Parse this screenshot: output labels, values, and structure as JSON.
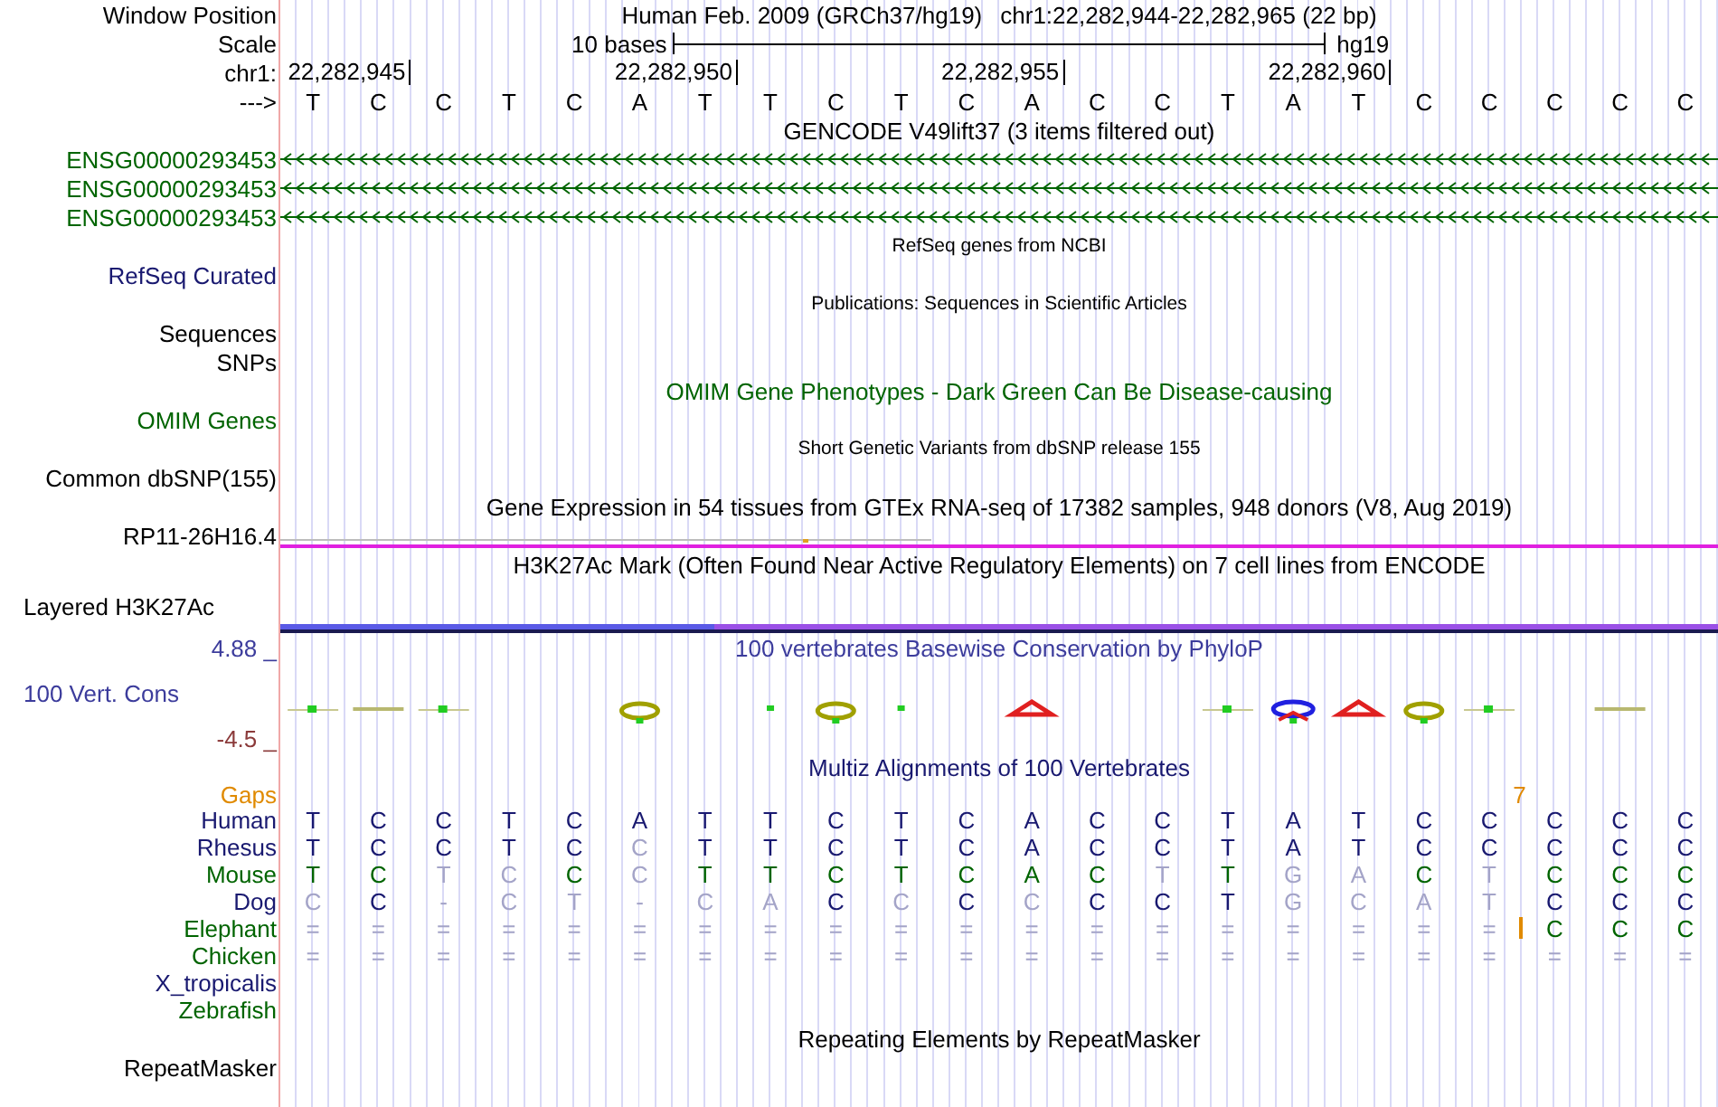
{
  "window_position": {
    "label": "Window Position",
    "assembly": "Human Feb. 2009 (GRCh37/hg19)",
    "range": "chr1:22,282,944-22,282,965 (22 bp)"
  },
  "scale": {
    "label": "Scale",
    "span": "10 bases",
    "assembly": "hg19"
  },
  "ruler": {
    "label": "chr1:",
    "ticks": [
      "22,282,945",
      "22,282,950",
      "22,282,955",
      "22,282,960"
    ]
  },
  "sequence": {
    "label": "--->",
    "bases": [
      "T",
      "C",
      "C",
      "T",
      "C",
      "A",
      "T",
      "T",
      "C",
      "T",
      "C",
      "A",
      "C",
      "C",
      "T",
      "A",
      "T",
      "C",
      "C",
      "C",
      "C",
      "C"
    ]
  },
  "tracks": [
    {
      "kind": "plain",
      "title": {
        "text": "GENCODE V49lift37 (3 items filtered out)",
        "color": "#000000"
      }
    },
    {
      "kind": "gene",
      "label": "ENSG00000293453",
      "color": "#006400"
    },
    {
      "kind": "gene",
      "label": "ENSG00000293453",
      "color": "#006400"
    },
    {
      "kind": "gene",
      "label": "ENSG00000293453",
      "color": "#006400"
    },
    {
      "kind": "note",
      "title": {
        "text": "RefSeq genes from NCBI",
        "color": "#000000"
      }
    },
    {
      "kind": "plain",
      "label": "RefSeq Curated",
      "color": "#191970"
    },
    {
      "kind": "note",
      "title": {
        "text": "Publications: Sequences in Scientific Articles",
        "color": "#000000"
      }
    },
    {
      "kind": "plain",
      "label": "Sequences",
      "color": "#000000"
    },
    {
      "kind": "plain",
      "label": "SNPs",
      "color": "#000000"
    },
    {
      "kind": "plain",
      "title": {
        "text": "OMIM Gene Phenotypes - Dark Green Can Be Disease-causing",
        "color": "#006400"
      }
    },
    {
      "kind": "plain",
      "label": "OMIM Genes",
      "color": "#006400"
    },
    {
      "kind": "note",
      "title": {
        "text": "Short Genetic Variants from dbSNP release 155",
        "color": "#000000"
      }
    },
    {
      "kind": "plain",
      "label": "Common dbSNP(155)",
      "color": "#000000"
    },
    {
      "kind": "plain",
      "title": {
        "text": "Gene Expression in 54 tissues from GTEx RNA-seq of 17382 samples, 948 donors (V8, Aug 2019)",
        "color": "#000000"
      }
    },
    {
      "kind": "expression",
      "label": "RP11-26H16.4",
      "color": "#000000"
    },
    {
      "kind": "plain",
      "title": {
        "text": "H3K27Ac Mark (Often Found Near Active Regulatory Elements) on 7 cell lines from ENCODE",
        "color": "#000000"
      }
    },
    {
      "kind": "signal",
      "label": "Layered H3K27Ac",
      "color": "#000000"
    },
    {
      "kind": "plain",
      "label": "4.88 _",
      "color": "#3c3c9c",
      "title": {
        "text": "100 vertebrates Basewise Conservation by PhyloP",
        "color": "#3c3c9c"
      }
    },
    {
      "kind": "conservation",
      "label": "100 Vert. Cons",
      "color": "#3c3c9c"
    },
    {
      "kind": "plain",
      "label": "-4.5 _",
      "color": "#8b3a3a"
    },
    {
      "kind": "plain",
      "title": {
        "text": "Multiz Alignments of 100 Vertebrates",
        "color": "#191970"
      }
    },
    {
      "kind": "gaps",
      "label": "Gaps",
      "color": "#e08a00",
      "count": "7"
    },
    {
      "kind": "alignment",
      "label": "Human",
      "color": "#191970",
      "bases": [
        "T",
        "C",
        "C",
        "T",
        "C",
        "A",
        "T",
        "T",
        "C",
        "T",
        "C",
        "A",
        "C",
        "C",
        "T",
        "A",
        "T",
        "C",
        "C",
        "C",
        "C",
        "C"
      ],
      "faded": [
        false,
        false,
        false,
        false,
        false,
        false,
        false,
        false,
        false,
        false,
        false,
        false,
        false,
        false,
        false,
        false,
        false,
        false,
        false,
        false,
        false,
        false
      ]
    },
    {
      "kind": "alignment",
      "label": "Rhesus",
      "color": "#191970",
      "bases": [
        "T",
        "C",
        "C",
        "T",
        "C",
        "C",
        "T",
        "T",
        "C",
        "T",
        "C",
        "A",
        "C",
        "C",
        "T",
        "A",
        "T",
        "C",
        "C",
        "C",
        "C",
        "C"
      ],
      "faded": [
        false,
        false,
        false,
        false,
        false,
        true,
        false,
        false,
        false,
        false,
        false,
        false,
        false,
        false,
        false,
        false,
        false,
        false,
        false,
        false,
        false,
        false
      ]
    },
    {
      "kind": "alignment",
      "label": "Mouse",
      "color": "#006400",
      "bases": [
        "T",
        "C",
        "T",
        "C",
        "C",
        "C",
        "T",
        "T",
        "C",
        "T",
        "C",
        "A",
        "C",
        "T",
        "T",
        "G",
        "A",
        "C",
        "T",
        "C",
        "C",
        "C"
      ],
      "faded": [
        false,
        false,
        true,
        true,
        false,
        true,
        false,
        false,
        false,
        false,
        false,
        false,
        false,
        true,
        false,
        true,
        true,
        false,
        true,
        false,
        false,
        false
      ]
    },
    {
      "kind": "alignment",
      "label": "Dog",
      "color": "#191970",
      "bases": [
        "C",
        "C",
        "-",
        "C",
        "T",
        "-",
        "C",
        "A",
        "C",
        "C",
        "C",
        "C",
        "C",
        "C",
        "T",
        "G",
        "C",
        "A",
        "T",
        "C",
        "C",
        "C"
      ],
      "faded": [
        true,
        false,
        true,
        true,
        true,
        true,
        true,
        true,
        false,
        true,
        false,
        true,
        false,
        false,
        false,
        true,
        true,
        true,
        true,
        false,
        false,
        false
      ]
    },
    {
      "kind": "alignment",
      "label": "Elephant",
      "color": "#006400",
      "bases": [
        "=",
        "=",
        "=",
        "=",
        "=",
        "=",
        "=",
        "=",
        "=",
        "=",
        "=",
        "=",
        "=",
        "=",
        "=",
        "=",
        "=",
        "=",
        "=",
        "C",
        "C",
        "C"
      ],
      "faded": [
        true,
        true,
        true,
        true,
        true,
        true,
        true,
        true,
        true,
        true,
        true,
        true,
        true,
        true,
        true,
        true,
        true,
        true,
        true,
        false,
        false,
        false
      ],
      "insert_before": [
        false,
        false,
        false,
        false,
        false,
        false,
        false,
        false,
        false,
        false,
        false,
        false,
        false,
        false,
        false,
        false,
        false,
        false,
        false,
        true,
        false,
        false
      ]
    },
    {
      "kind": "alignment",
      "label": "Chicken",
      "color": "#006400",
      "bases": [
        "=",
        "=",
        "=",
        "=",
        "=",
        "=",
        "=",
        "=",
        "=",
        "=",
        "=",
        "=",
        "=",
        "=",
        "=",
        "=",
        "=",
        "=",
        "=",
        "=",
        "=",
        "="
      ],
      "faded": [
        true,
        true,
        true,
        true,
        true,
        true,
        true,
        true,
        true,
        true,
        true,
        true,
        true,
        true,
        true,
        true,
        true,
        true,
        true,
        true,
        true,
        true
      ]
    },
    {
      "kind": "alignment",
      "label": "X_tropicalis",
      "color": "#191970"
    },
    {
      "kind": "alignment",
      "label": "Zebrafish",
      "color": "#006400"
    },
    {
      "kind": "plain",
      "title": {
        "text": "Repeating Elements by RepeatMasker",
        "color": "#000000"
      }
    },
    {
      "kind": "plain",
      "label": "RepeatMasker",
      "color": "#000000"
    }
  ]
}
